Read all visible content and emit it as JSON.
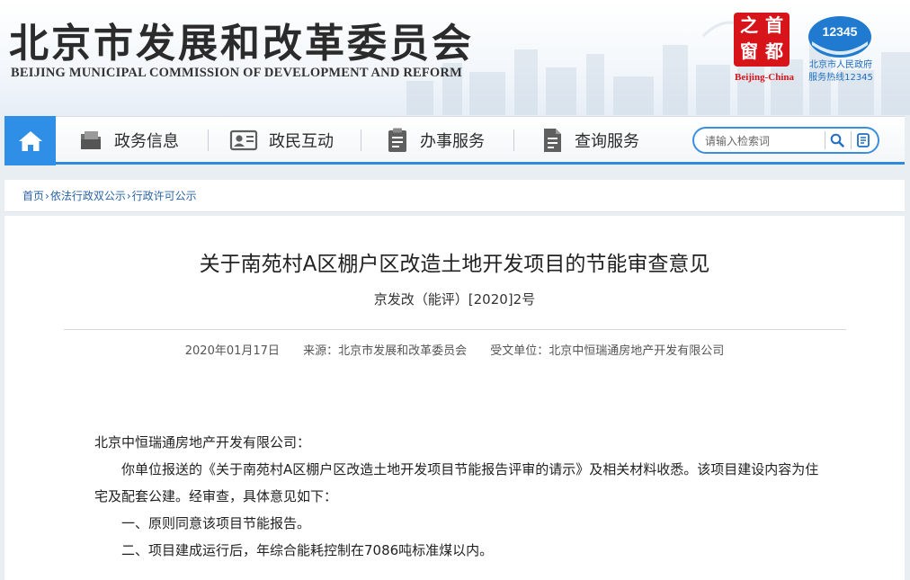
{
  "header": {
    "title": "北京市发展和改革委员会",
    "subtitle": "BEIJING MUNICIPAL COMMISSION OF DEVELOPMENT AND REFORM",
    "capital_logo": {
      "chars": [
        "之",
        "首",
        "窗",
        "都"
      ],
      "caption": "Beijing-China"
    },
    "hotline": {
      "number": "12345",
      "caption_line1": "北京市人民政府",
      "caption_line2": "服务热线12345"
    },
    "brand_color": "#2f8fe6"
  },
  "nav": {
    "home_icon": "house-icon",
    "items": [
      {
        "label": "政务信息",
        "icon": "folder-icon"
      },
      {
        "label": "政民互动",
        "icon": "id-card-icon"
      },
      {
        "label": "办事服务",
        "icon": "clipboard-icon"
      },
      {
        "label": "查询服务",
        "icon": "document-icon"
      }
    ],
    "search": {
      "placeholder": "请输入检索词",
      "search_icon": "search-icon",
      "voice_icon": "voice-icon"
    }
  },
  "breadcrumb": [
    "首页",
    "依法行政双公示",
    "行政许可公示"
  ],
  "article": {
    "title": "关于南苑村A区棚户区改造土地开发项目的节能审查意见",
    "doc_number": "京发改（能评）[2020]2号",
    "date": "2020年01月17日",
    "source": "来源：北京市发展和改革委员会",
    "recipient": "受文单位：北京中恒瑞通房地产开发有限公司",
    "salutation": "北京中恒瑞通房地产开发有限公司：",
    "paragraphs": [
      "你单位报送的《关于南苑村A区棚户区改造土地开发项目节能报告评审的请示》及相关材料收悉。该项目建设内容为住宅及配套公建。经审查，具体意见如下：",
      "一、原则同意该项目节能报告。",
      "二、项目建成运行后，年综合能耗控制在7086吨标准煤以内。"
    ]
  }
}
